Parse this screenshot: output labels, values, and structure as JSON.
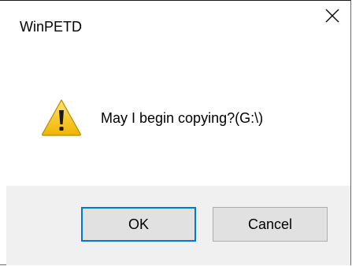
{
  "window": {
    "title": "WinPETD"
  },
  "message": {
    "text": "May I begin copying?(G:\\)",
    "icon": "warning-icon"
  },
  "buttons": {
    "ok_label": "OK",
    "cancel_label": "Cancel"
  },
  "colors": {
    "footer_bg": "#f0f0f0",
    "button_bg": "#e1e1e1",
    "default_button_border": "#0078d7",
    "warning_yellow": "#f4c400"
  }
}
